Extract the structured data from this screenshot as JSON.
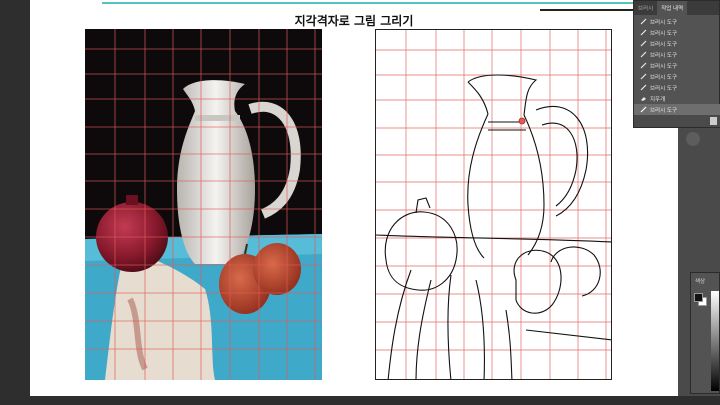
{
  "document": {
    "title": "지각격자로 그림 그리기"
  },
  "history_panel": {
    "tabs": [
      {
        "label": "브러시"
      },
      {
        "label": "작업 내역"
      }
    ],
    "active_tab": 1,
    "items": [
      {
        "label": "브러시 도구",
        "icon": "brush-icon"
      },
      {
        "label": "브러시 도구",
        "icon": "brush-icon"
      },
      {
        "label": "브러시 도구",
        "icon": "brush-icon"
      },
      {
        "label": "브러시 도구",
        "icon": "brush-icon"
      },
      {
        "label": "브러시 도구",
        "icon": "brush-icon"
      },
      {
        "label": "브러시 도구",
        "icon": "brush-icon"
      },
      {
        "label": "브러시 도구",
        "icon": "brush-icon"
      },
      {
        "label": "지우개",
        "icon": "eraser-icon"
      },
      {
        "label": "브러시 도구",
        "icon": "brush-icon"
      }
    ],
    "selected_index": 8
  },
  "color_panel": {
    "label": "색상",
    "foreground": "#111111",
    "background": "#ffffff"
  },
  "colors": {
    "accent_line": "#56c3c1",
    "grid_line": "#e05a5a",
    "table_blue": "#3fa9c9"
  }
}
